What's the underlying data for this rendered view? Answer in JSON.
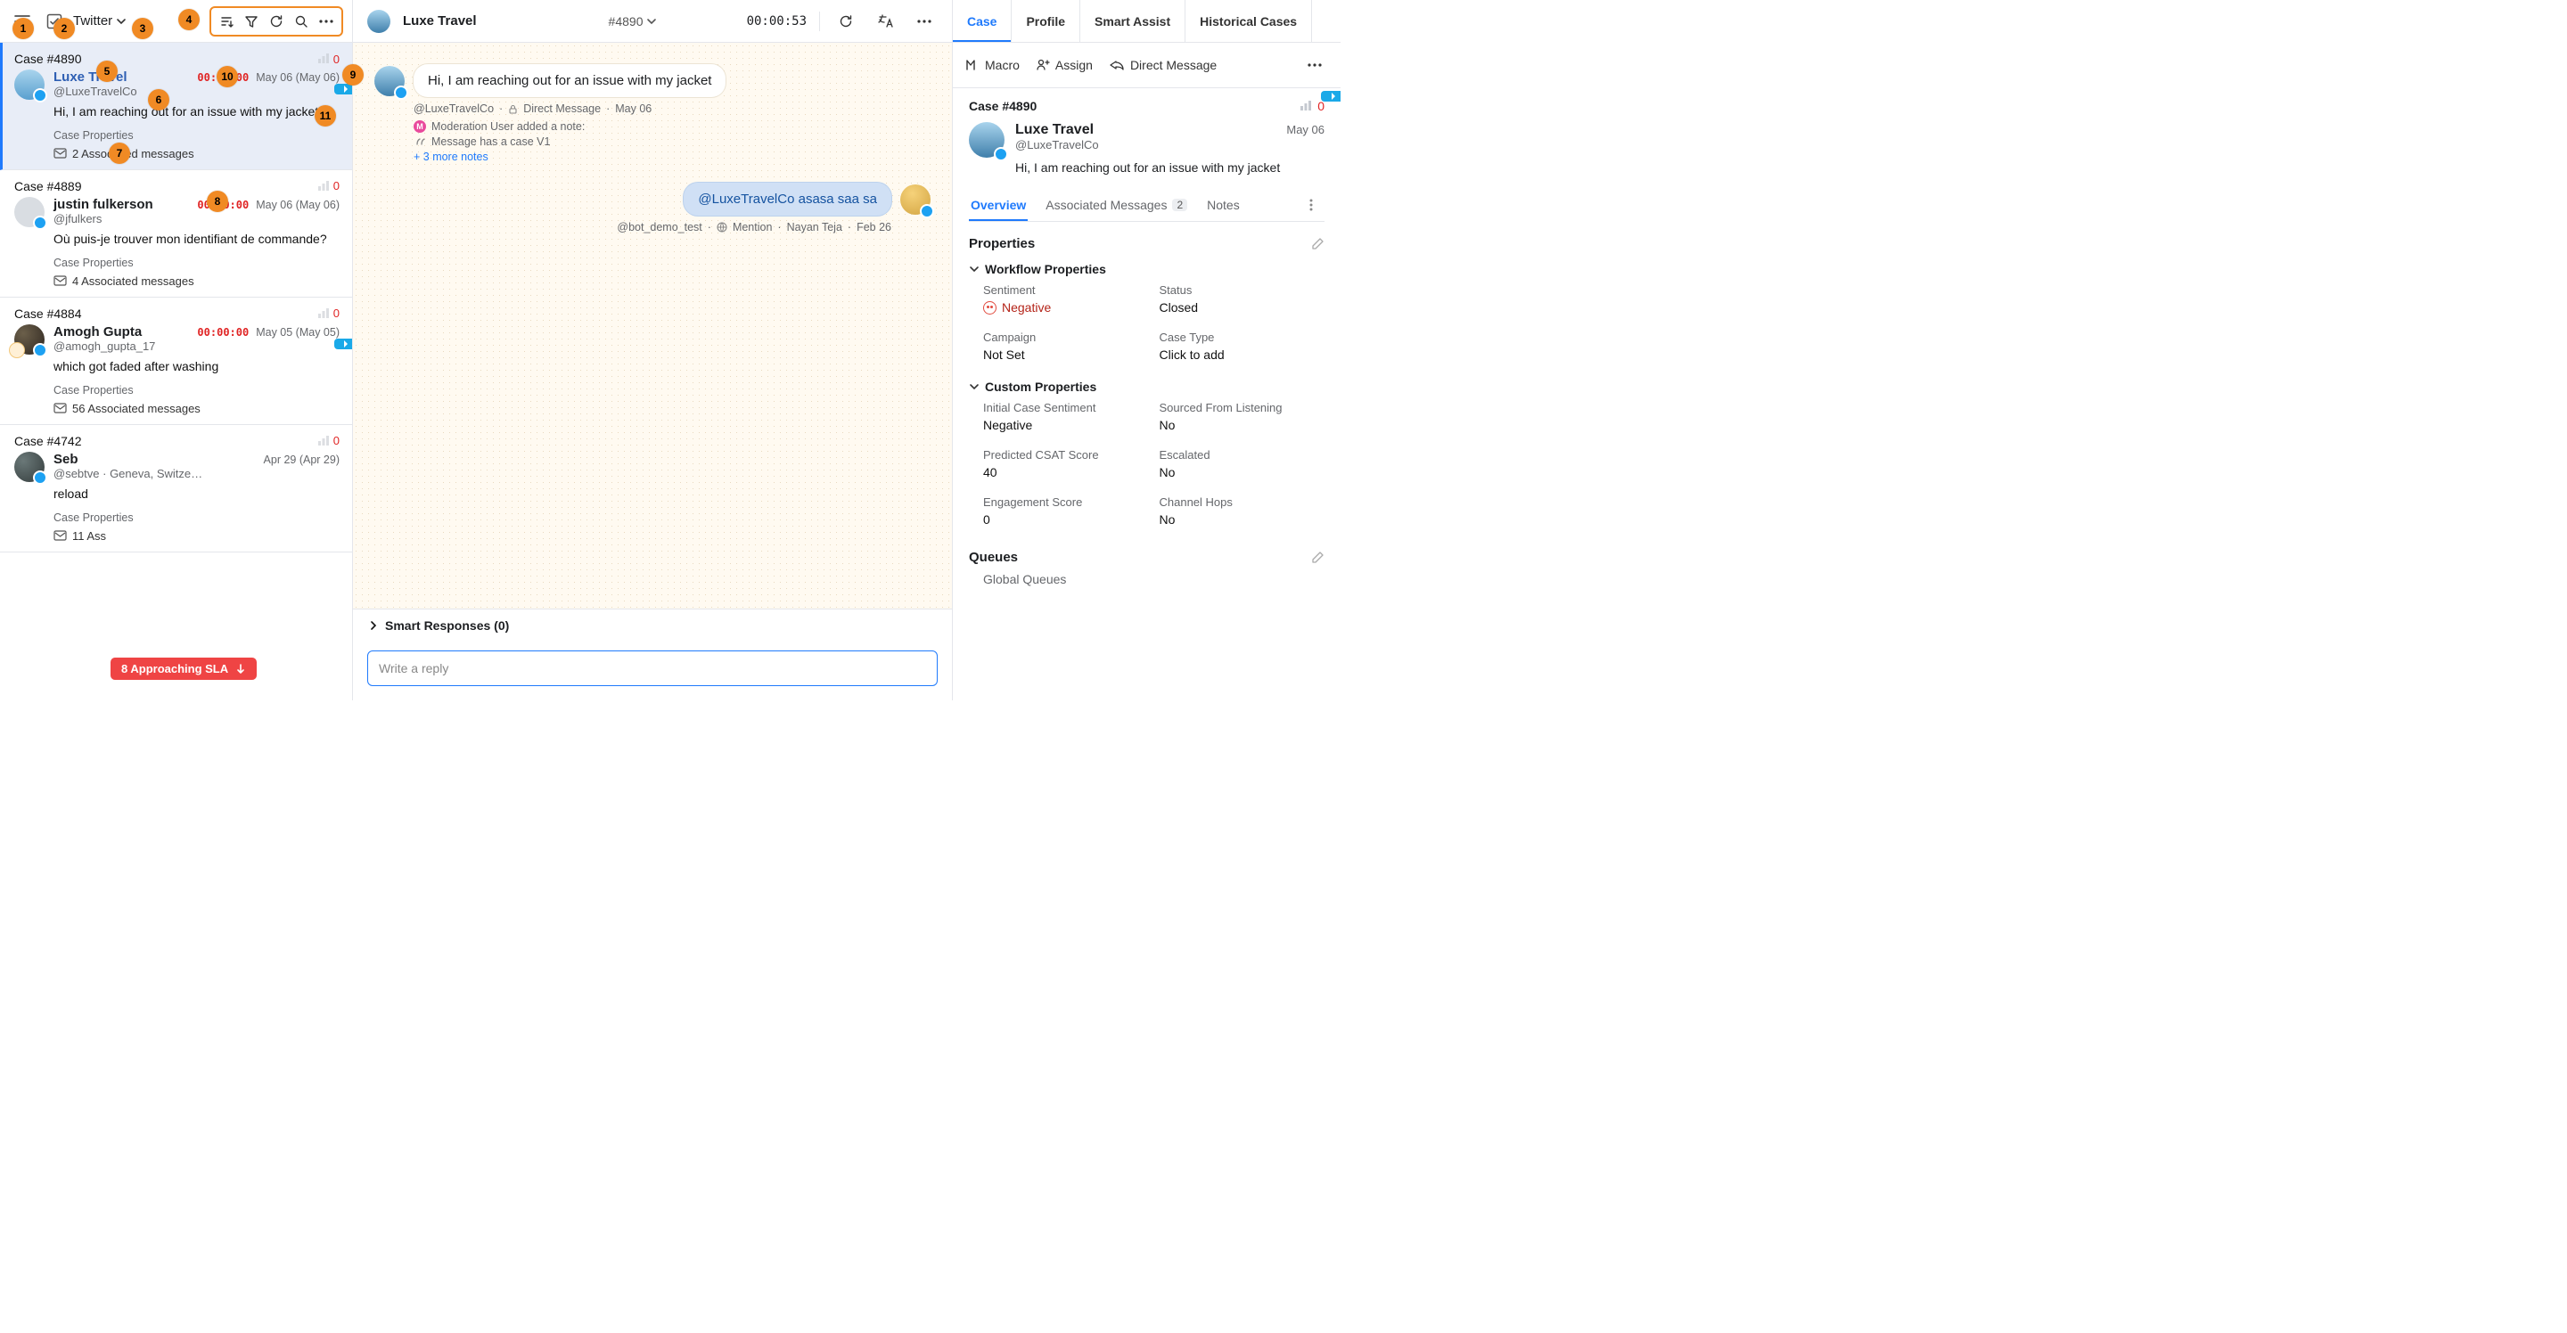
{
  "left": {
    "channel": "Twitter",
    "toolbox_box_enabled": true,
    "cases": [
      {
        "case_no": "Case #4890",
        "metric": "0",
        "name": "Luxe Travel",
        "is_link": true,
        "handle": "@LuxeTravelCo",
        "timer": "00:00:00",
        "date1": "May 06",
        "date2": "(May 06)",
        "snippet": "Hi, I am reaching out for an issue with my jacket",
        "props_label": "Case Properties",
        "assoc": "2 Associated messages",
        "selected": true,
        "has_reply_tag": true,
        "avatar_class": ""
      },
      {
        "case_no": "Case #4889",
        "metric": "0",
        "name": "justin fulkerson",
        "handle": "@jfulkers",
        "timer": "00:00:00",
        "date1": "May 06",
        "date2": "(May 06)",
        "snippet": "Où puis-je trouver mon identifiant de commande?",
        "props_label": "Case Properties",
        "assoc": "4 Associated messages",
        "avatar_class": "grey"
      },
      {
        "case_no": "Case #4884",
        "metric": "0",
        "name": "Amogh Gupta",
        "handle": "@amogh_gupta_17",
        "timer": "00:00:00",
        "date1": "May 05",
        "date2": "(May 05)",
        "snippet": "which got faded after washing",
        "props_label": "Case Properties",
        "assoc": "56 Associated messages",
        "has_reply_tag": true,
        "avatar_class": "photo1",
        "has_bird": true
      },
      {
        "case_no": "Case #4742",
        "metric": "0",
        "name": "Seb",
        "handle": "@sebtve",
        "extra_loc": "· Geneva, Switze…",
        "date1": "Apr 29",
        "date2": "(Apr 29)",
        "snippet": "reload",
        "props_label": "Case Properties",
        "assoc": "11 Ass",
        "avatar_class": "photo2"
      }
    ],
    "sla": "8 Approaching SLA"
  },
  "mid": {
    "header_name": "Luxe Travel",
    "case_no": "#4890",
    "timer": "00:00:53",
    "messages": [
      {
        "direction": "in",
        "text": "Hi, I am reaching out for an issue with my jacket",
        "meta_handle": "@LuxeTravelCo",
        "meta_channel": "Direct Message",
        "meta_date": "May 06",
        "note_author": "Moderation User added a note:",
        "note_text": "Message has a case V1",
        "more_notes": "+ 3 more notes"
      },
      {
        "direction": "out",
        "mention": "@LuxeTravelCo",
        "rest": " asasa saa sa",
        "meta_handle": "@bot_demo_test",
        "meta_channel": "Mention",
        "meta_user": "Nayan Teja",
        "meta_date": "Feb 26"
      }
    ],
    "smart_responses": "Smart Responses (0)",
    "reply_placeholder": "Write a reply"
  },
  "right": {
    "tabs": [
      "Case",
      "Profile",
      "Smart Assist",
      "Historical Cases"
    ],
    "active_tab": 0,
    "actions": {
      "macro": "Macro",
      "assign": "Assign",
      "dm": "Direct Message"
    },
    "case_no": "Case #4890",
    "case_metric": "0",
    "summary": {
      "name": "Luxe Travel",
      "handle": "@LuxeTravelCo",
      "date": "May 06",
      "snippet": "Hi, I am reaching out for an issue with my jacket"
    },
    "subtabs": {
      "overview": "Overview",
      "assoc": "Associated Messages",
      "assoc_n": "2",
      "notes": "Notes"
    },
    "properties_title": "Properties",
    "workflow_title": "Workflow Properties",
    "workflow": [
      {
        "label": "Sentiment",
        "value": "Negative",
        "neg": true
      },
      {
        "label": "Status",
        "value": "Closed"
      },
      {
        "label": "Campaign",
        "value": "Not Set"
      },
      {
        "label": "Case Type",
        "value": "Click to add"
      }
    ],
    "custom_title": "Custom Properties",
    "custom": [
      {
        "label": "Initial Case Sentiment",
        "value": "Negative"
      },
      {
        "label": "Sourced From Listening",
        "value": "No"
      },
      {
        "label": "Predicted CSAT Score",
        "value": "40"
      },
      {
        "label": "Escalated",
        "value": "No"
      },
      {
        "label": "Engagement Score",
        "value": "0"
      },
      {
        "label": "Channel Hops",
        "value": "No"
      }
    ],
    "queues_title": "Queues",
    "queues_sub": "Global Queues"
  },
  "annotations": [
    1,
    2,
    3,
    4,
    5,
    6,
    7,
    8,
    9,
    10,
    11
  ]
}
